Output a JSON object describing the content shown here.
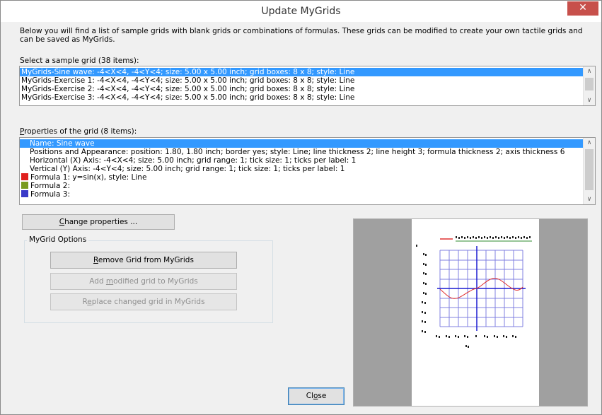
{
  "window": {
    "title": "Update MyGrids",
    "close_glyph": "✕"
  },
  "intro_text": "Below you will find a list of sample grids with blank grids or combinations of formulas. These grids can be modified to create your own tactile grids and can be saved as MyGrids.",
  "sample_grid": {
    "label_pre": "Select a sample ",
    "label_u": "g",
    "label_post": "rid (38 items):",
    "items": [
      "MyGrids-Sine wave: -4<X<4, -4<Y<4; size: 5.00 x 5.00 inch; grid boxes: 8 x 8; style: Line",
      "MyGrids-Exercise 1: -4<X<4, -4<Y<4; size: 5.00 x 5.00 inch; grid boxes: 8 x 8; style: Line",
      "MyGrids-Exercise 2: -4<X<4, -4<Y<4; size: 5.00 x 5.00 inch; grid boxes: 8 x 8; style: Line",
      "MyGrids-Exercise 3: -4<X<4, -4<Y<4; size: 5.00 x 5.00 inch; grid boxes: 8 x 8; style: Line"
    ],
    "selected_index": 0
  },
  "properties": {
    "label_u": "P",
    "label_post": "roperties of the grid (8 items):",
    "name": "Name: Sine wave",
    "positions": "Positions and Appearance: position: 1.80, 1.80 inch; border yes; style: Line; line thickness 2; line height 3; formula thickness 2; axis thickness 6",
    "horizontal": "Horizontal (X) Axis: -4<X<4; size: 5.00 inch; grid range: 1; tick size: 1; ticks per label: 1",
    "vertical": "Vertical (Y) Axis: -4<Y<4; size: 5.00 inch; grid range: 1; tick size: 1; ticks per label: 1",
    "formulas": [
      {
        "text": "Formula 1: y=sin(x), style: Line",
        "color": "#e0201e"
      },
      {
        "text": "Formula 2:",
        "color": "#7a9a1e"
      },
      {
        "text": "Formula 3:",
        "color": "#3a3ac8"
      }
    ]
  },
  "buttons": {
    "change_u": "C",
    "change_post": "hange properties ...",
    "remove_u": "R",
    "remove_post": "emove Grid from MyGrids",
    "add_pre": "Add ",
    "add_u": "m",
    "add_post": "odified grid to MyGrids",
    "replace_pre": "R",
    "replace_u": "e",
    "replace_post": "place changed grid in MyGrids",
    "close_pre": "Cl",
    "close_u": "o",
    "close_post": "se"
  },
  "options_title": "MyGrid Options",
  "colors": {
    "selection": "#3399ff",
    "grid": "#8080e0",
    "axis": "#1a1ad0",
    "curve": "#e03030",
    "title_line": "#2e8b2e",
    "close_button": "#c7504b"
  },
  "preview": {
    "header_text": "MyGrids-Sine wave: -4<X<4, -4<Y<4"
  }
}
